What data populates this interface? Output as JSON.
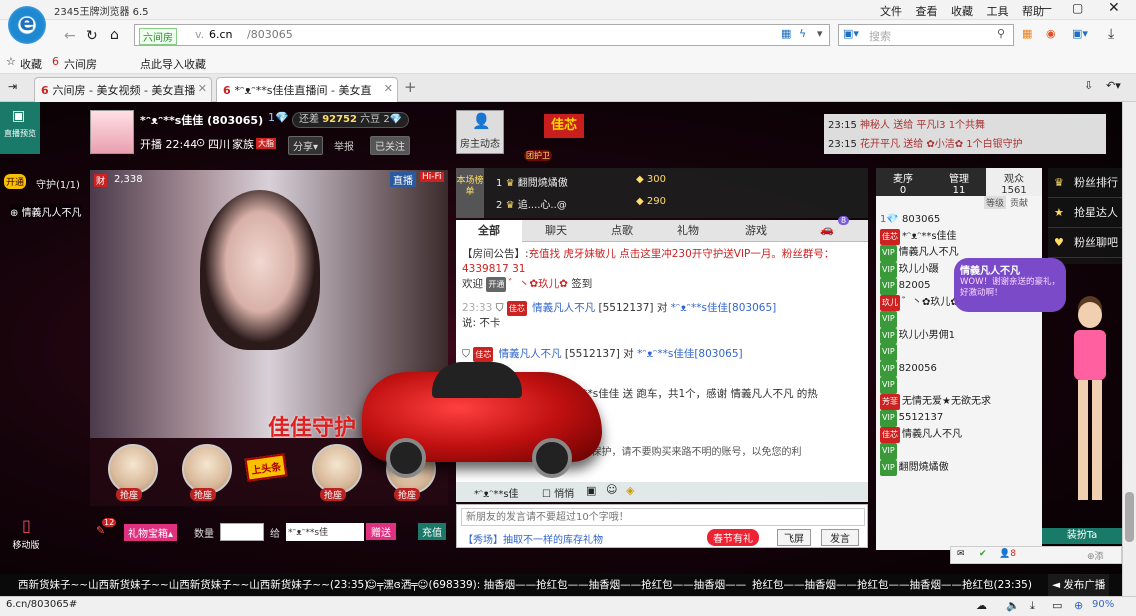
{
  "browser": {
    "title": "2345王牌浏览器 6.5",
    "menu": [
      "文件",
      "查看",
      "收藏",
      "工具",
      "帮助"
    ],
    "url_prefix": "v.",
    "url_domain": "6.cn",
    "url_path": "/803065",
    "site_badge": "六间房",
    "search_placeholder": "搜索",
    "bookmarks": [
      "收藏",
      "六间房",
      "点此导入收藏"
    ],
    "tabs": [
      "六间房 - 美女视频 - 美女直播",
      "*ᵔᴥᵔ**s佳佳直播间 - 美女直"
    ],
    "status_url": "6.cn/803065#",
    "zoom": "90%"
  },
  "room": {
    "host_name": "*ᵔᴥᵔ**s佳佳 (803065)",
    "rank_gap_label": "还差",
    "rank_gap_value": "92752",
    "rank_next": "六豆",
    "level": "2",
    "live_time": "开播 22:44",
    "location": "四川",
    "family_label": "家族",
    "share": "分享▾",
    "report": "举报",
    "followed": "已关注",
    "host_dynamic": "房主动态",
    "flag_text": "佳芯",
    "team_label": "团护卫",
    "live_badge": "直播",
    "hifi": "Hi-Fi",
    "viewers": "2,338",
    "video_banner": "佳佳守护",
    "guard": "守护(1/1)",
    "guard_open": "开通",
    "guard_user": "情義凡人不凡",
    "room_preview": "直播预览",
    "mobile": "移动版"
  },
  "top_msgs": [
    {
      "time": "23:15",
      "text": "神秘人 送给 平凡l3 1个共舞"
    },
    {
      "time": "23:15",
      "text": "花开平凡 送给 ✿小洁✿ 1个白银守护"
    }
  ],
  "leaderboard": {
    "title": "本场榜单",
    "entries": [
      {
        "rank": "1",
        "name": "翻閲燒燏傲",
        "amount": "300"
      },
      {
        "rank": "2",
        "name": "追....心..@",
        "amount": "290"
      }
    ]
  },
  "chat": {
    "tabs": [
      "全部",
      "聊天",
      "点歌",
      "礼物",
      "游戏"
    ],
    "car_count": "8",
    "notice_label": "【房间公告】:",
    "notice": "充值找 虎牙妹敏儿 点击这里冲230开守护送VIP一月。粉丝群号：4339817 31",
    "welcome": "欢迎",
    "welcome_name": "゛丶✿玖儿✿",
    "welcome_tail": "签到",
    "lines": [
      {
        "time": "23:33",
        "tag": "佳芯",
        "user": "情義凡人不凡",
        "uid": "[5512137]",
        "to": "对",
        "target": "*ᵔᴥᵔ**s佳佳[803065]",
        "say_label": "说:",
        "say": "不卡"
      },
      {
        "time": "",
        "tag": "佳芯",
        "user": "情義凡人不凡",
        "uid": "[5512137]",
        "to": "对",
        "target": "*ᵔᴥᵔ**s佳佳[803065]",
        "say_label": "",
        "say": ""
      }
    ],
    "gift_line": "*ᵔᴥᵔ**s佳佳 送 跑车，共1个，感谢 情義凡人不凡 的热",
    "warn1": "...不受保护，请不要购买来路不明的账号，以免您的利",
    "target_select": "*ᵔᴥᵔ**s佳",
    "quiet": "悄悄",
    "input_placeholder": "新朋友的发言请不要超过10个字哦！",
    "promo": "【秀场】抽取不一样的库存礼物",
    "spring": "春节有礼",
    "fly": "飞屏",
    "send": "发言"
  },
  "users": {
    "tabs": [
      "麦序",
      "管理",
      "观众"
    ],
    "counts": [
      "0",
      "11",
      "1561"
    ],
    "sub_tabs": [
      "等级",
      "贡献"
    ],
    "list": [
      {
        "id": "803065",
        "tag": "",
        "name": ""
      },
      {
        "id": "",
        "tag": "佳芯",
        "name": "*ᵔᴥᵔ**s佳佳"
      },
      {
        "id": "",
        "tag": "",
        "name": "情義凡人不凡"
      },
      {
        "id": "",
        "tag": "",
        "name": "玖儿小蹑"
      },
      {
        "id": "82005",
        "tag": "",
        "name": ""
      },
      {
        "id": "",
        "tag": "玖儿",
        "name": "゛丶✿玖儿✿"
      },
      {
        "id": "",
        "tag": "",
        "name": ""
      },
      {
        "id": "",
        "tag": "",
        "name": "玖儿小男佣1"
      },
      {
        "id": "",
        "tag": "",
        "name": ""
      },
      {
        "id": "820056",
        "tag": "",
        "name": ""
      },
      {
        "id": "",
        "tag": "",
        "name": ""
      },
      {
        "id": "",
        "tag": "芳菲",
        "name": "无情无爱★无欲无求"
      },
      {
        "id": "5512137",
        "tag": "",
        "name": ""
      },
      {
        "id": "",
        "tag": "佳芯",
        "name": "情義凡人不凡"
      },
      {
        "id": "",
        "tag": "",
        "name": ""
      },
      {
        "id": "",
        "tag": "",
        "name": "翻閲燒燏傲"
      }
    ]
  },
  "right_panel": {
    "ranks": [
      "粉丝排行",
      "抢星达人",
      "粉丝聊吧"
    ],
    "bubble_name": "情義凡人不凡",
    "bubble_text": "WOW！谢谢亲送的豪礼，好激动啊！",
    "dress": "装扮Ta"
  },
  "gift_bar": {
    "count": "12",
    "box": "礼物宝箱▴",
    "qty_label": "数量",
    "to_label": "给",
    "target": "*ᵔᴥᵔ**s佳",
    "gift_btn": "赠送",
    "recharge": "充值",
    "seats": [
      "抢座",
      "抢座",
      "抢座",
      "抢座"
    ],
    "headline": "上头条"
  },
  "ticker": {
    "left": "西新货妹子~~山西新货妹子~~山西新货妹子~~山西新货妹子~~(23:35)",
    "mid": "☺╤潶ɞ洒╤☺(698339): 抽香烟——抢红包——抽香烟——抢红包——抽香烟——",
    "right": "抢红包——抽香烟——抢红包——抽香烟——抢红包(23:35)",
    "broadcast": "发布广播"
  },
  "mini_toolbar": {
    "count": "8",
    "label": "添"
  }
}
